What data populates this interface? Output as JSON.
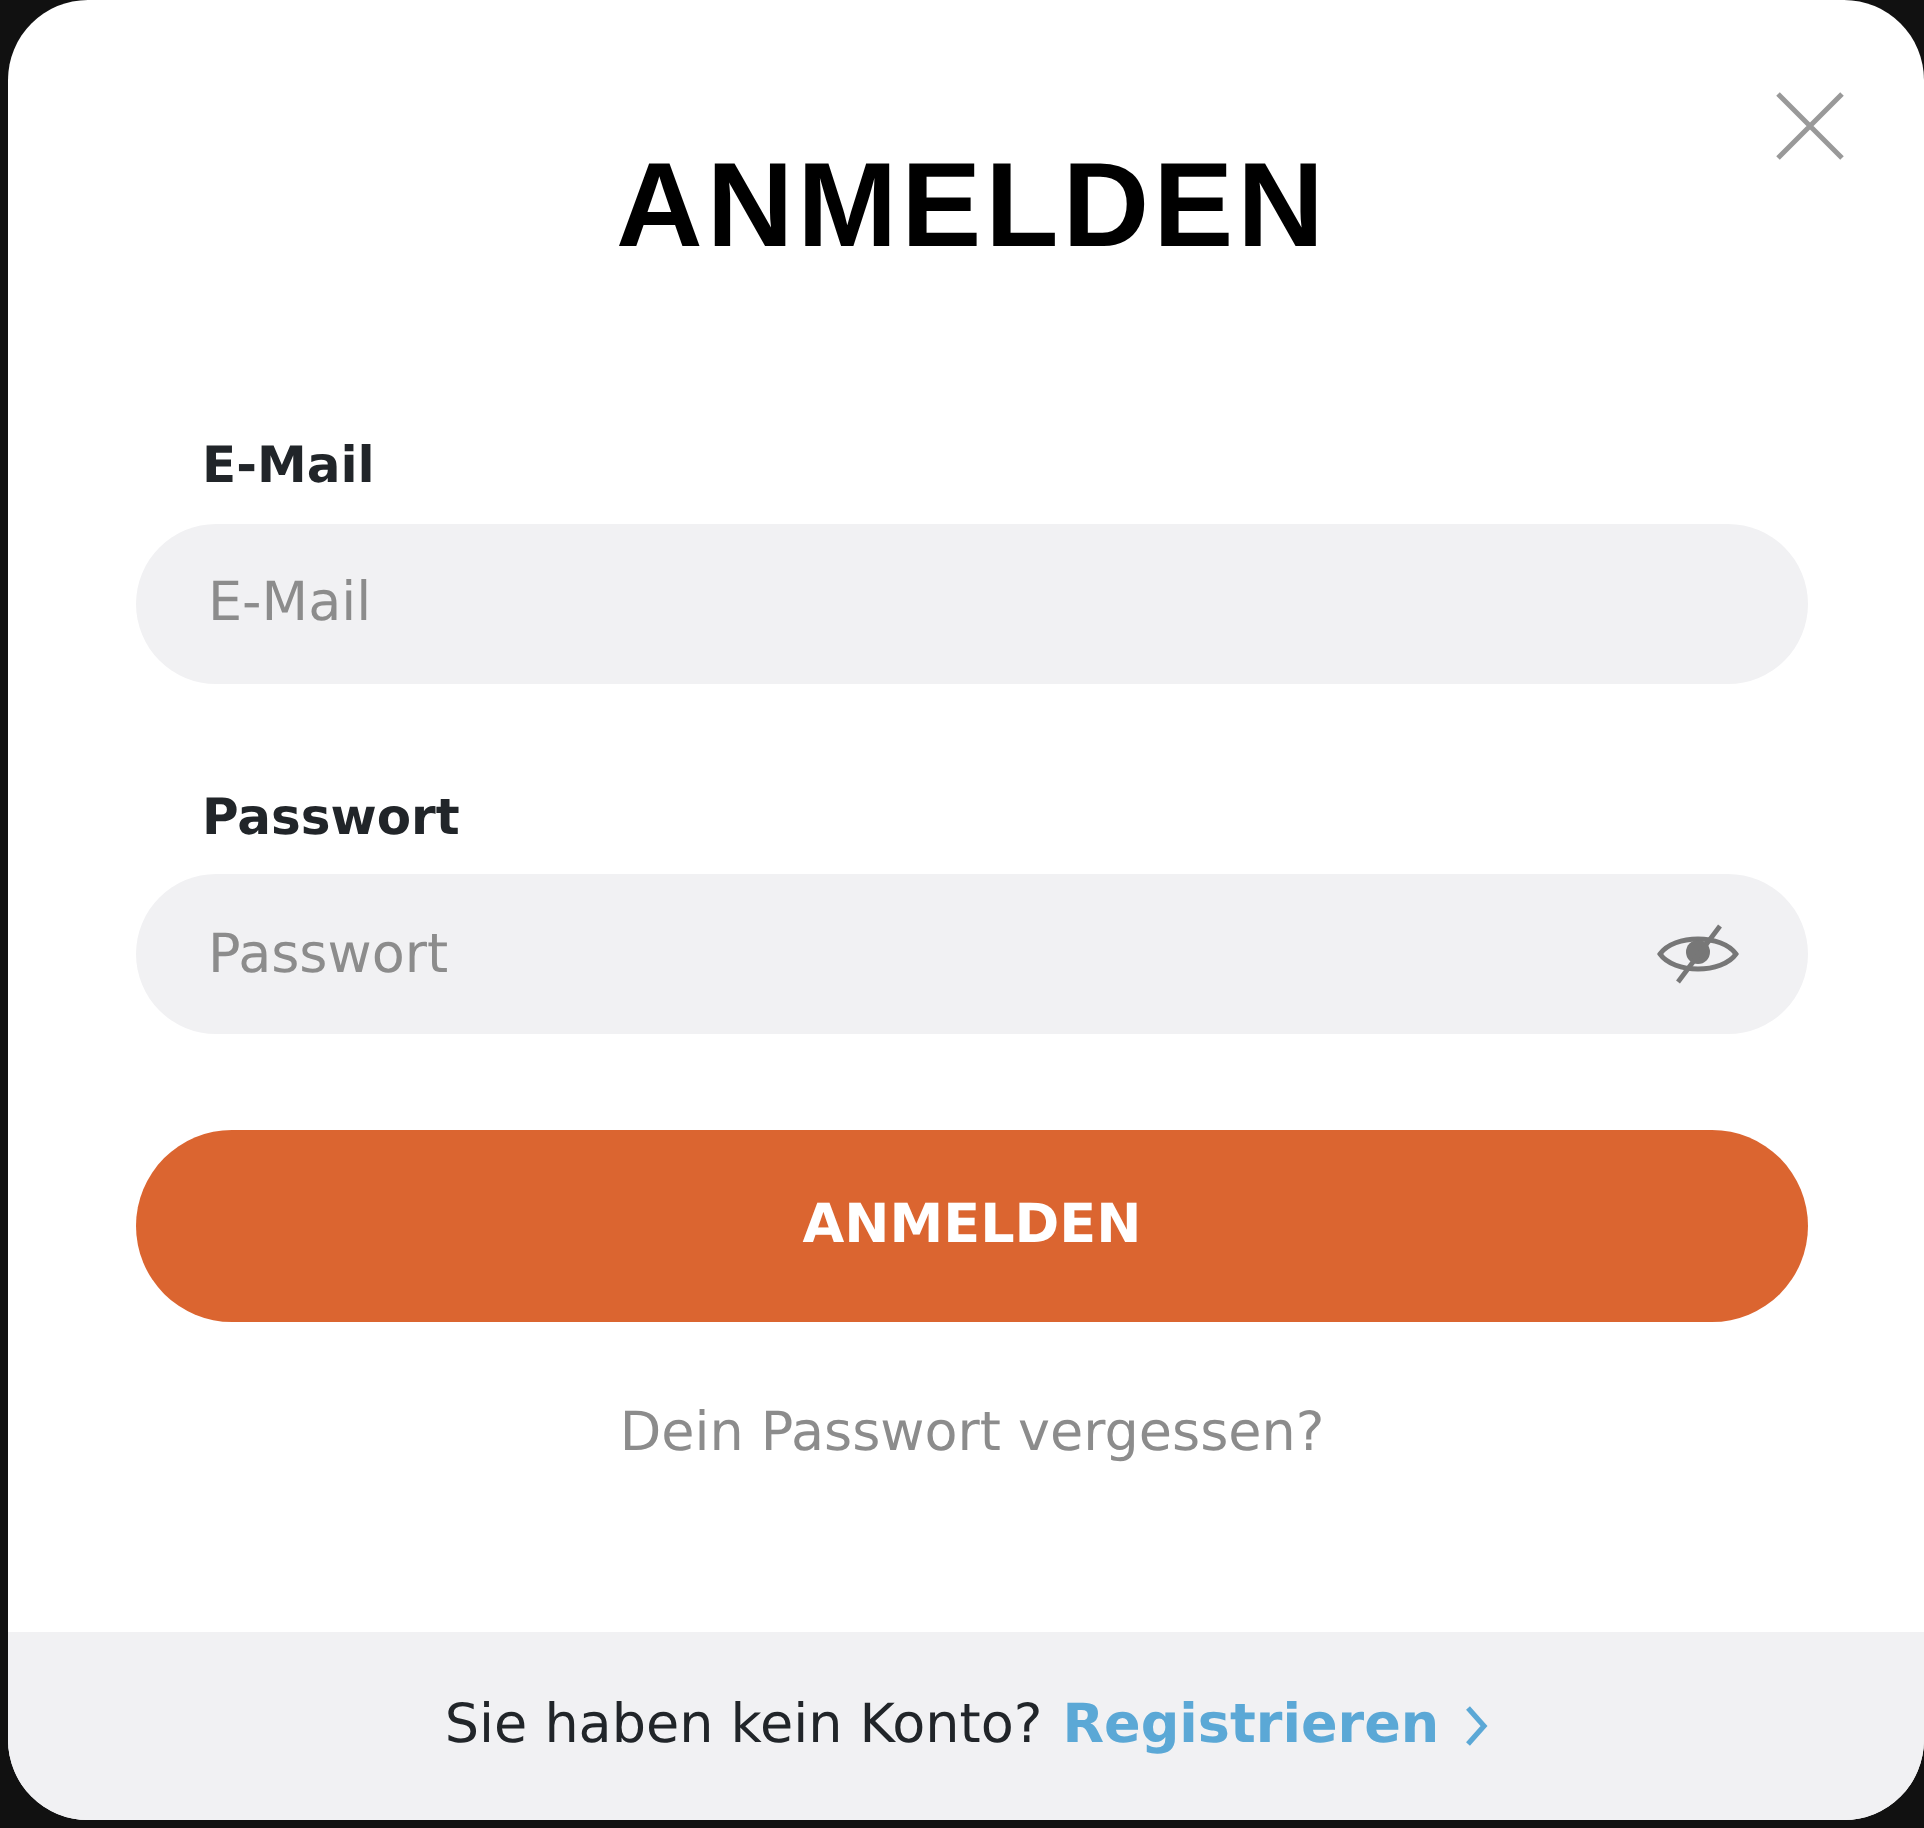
{
  "title": "ANMELDEN",
  "fields": [
    {
      "label": "E-Mail",
      "placeholder": "E-Mail",
      "kind": "text"
    },
    {
      "label": "Passwort",
      "placeholder": "Passwort",
      "kind": "password"
    }
  ],
  "submit": "ANMELDEN",
  "forgot_link": "Dein Passwort vergessen?",
  "footer": {
    "text": "Sie haben kein Konto?",
    "link": "Registrieren"
  }
}
